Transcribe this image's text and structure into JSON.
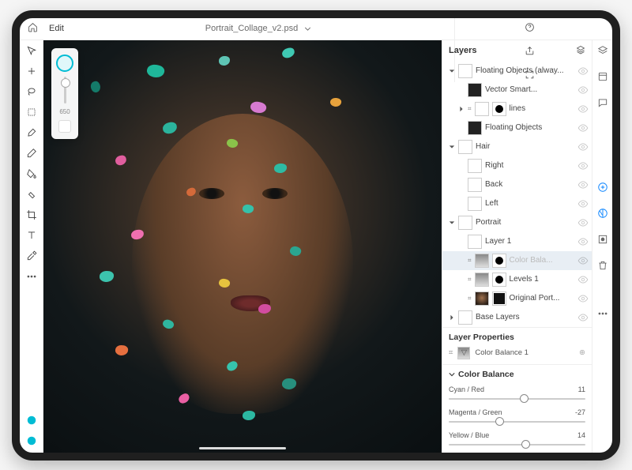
{
  "header": {
    "edit_label": "Edit",
    "filename": "Portrait_Collage_v2.psd"
  },
  "brush": {
    "size": "650"
  },
  "layers_panel": {
    "title": "Layers",
    "groups": [
      {
        "name": "Floating Objects (alway...",
        "expanded": true,
        "children": [
          {
            "name": "Vector Smart...",
            "thumb": "dark"
          },
          {
            "name": "lines",
            "thumb": "white",
            "mask": true,
            "collapsed": true
          },
          {
            "name": "Floating Objects",
            "thumb": "dark"
          }
        ]
      },
      {
        "name": "Hair",
        "expanded": true,
        "children": [
          {
            "name": "Right",
            "thumb": "white"
          },
          {
            "name": "Back",
            "thumb": "white"
          },
          {
            "name": "Left",
            "thumb": "white"
          }
        ]
      },
      {
        "name": "Portrait",
        "expanded": true,
        "children": [
          {
            "name": "Layer 1",
            "thumb": "white"
          },
          {
            "name": "Color Bala...",
            "thumb": "grad",
            "mask": true,
            "selected": true,
            "dim": true
          },
          {
            "name": "Levels 1",
            "thumb": "grad",
            "mask": true
          },
          {
            "name": "Original Port...",
            "thumb": "port",
            "mask_inv": true
          }
        ]
      },
      {
        "name": "Base Layers",
        "expanded": false
      }
    ]
  },
  "layer_properties": {
    "title": "Layer Properties",
    "current": "Color Balance 1"
  },
  "color_balance": {
    "title": "Color Balance",
    "sliders": [
      {
        "label": "Cyan / Red",
        "value": 11
      },
      {
        "label": "Magenta / Green",
        "value": -27
      },
      {
        "label": "Yellow / Blue",
        "value": 14
      }
    ]
  },
  "flecks": [
    {
      "t": 6,
      "l": 26,
      "w": 22,
      "h": 16,
      "c": "#1fb79a"
    },
    {
      "t": 4,
      "l": 44,
      "w": 14,
      "h": 12,
      "c": "#5ec4b4"
    },
    {
      "t": 10,
      "l": 12,
      "w": 12,
      "h": 14,
      "c": "#147a69"
    },
    {
      "t": 2,
      "l": 60,
      "w": 16,
      "h": 12,
      "c": "#3fc9b3"
    },
    {
      "t": 15,
      "l": 52,
      "w": 20,
      "h": 14,
      "c": "#d77ad0"
    },
    {
      "t": 14,
      "l": 72,
      "w": 14,
      "h": 11,
      "c": "#e7a23c"
    },
    {
      "t": 20,
      "l": 30,
      "w": 18,
      "h": 14,
      "c": "#2bb39c"
    },
    {
      "t": 24,
      "l": 46,
      "w": 14,
      "h": 11,
      "c": "#8ac34a"
    },
    {
      "t": 28,
      "l": 18,
      "w": 14,
      "h": 12,
      "c": "#e05e9e"
    },
    {
      "t": 30,
      "l": 58,
      "w": 16,
      "h": 12,
      "c": "#2ebba3"
    },
    {
      "t": 36,
      "l": 36,
      "w": 12,
      "h": 10,
      "c": "#d46a3a"
    },
    {
      "t": 40,
      "l": 50,
      "w": 14,
      "h": 11,
      "c": "#35c1aa"
    },
    {
      "t": 46,
      "l": 22,
      "w": 16,
      "h": 12,
      "c": "#ef6fb0"
    },
    {
      "t": 50,
      "l": 62,
      "w": 14,
      "h": 12,
      "c": "#2aa590"
    },
    {
      "t": 56,
      "l": 14,
      "w": 18,
      "h": 14,
      "c": "#3cc3ad"
    },
    {
      "t": 58,
      "l": 44,
      "w": 14,
      "h": 11,
      "c": "#e6c23e"
    },
    {
      "t": 64,
      "l": 54,
      "w": 16,
      "h": 12,
      "c": "#d24ca0"
    },
    {
      "t": 68,
      "l": 30,
      "w": 14,
      "h": 11,
      "c": "#2fb69f"
    },
    {
      "t": 74,
      "l": 18,
      "w": 16,
      "h": 13,
      "c": "#e56f3f"
    },
    {
      "t": 78,
      "l": 46,
      "w": 14,
      "h": 11,
      "c": "#36c4ad"
    },
    {
      "t": 82,
      "l": 60,
      "w": 18,
      "h": 14,
      "c": "#278f7d"
    },
    {
      "t": 86,
      "l": 34,
      "w": 14,
      "h": 11,
      "c": "#e95fa3"
    },
    {
      "t": 90,
      "l": 50,
      "w": 16,
      "h": 12,
      "c": "#2cb8a1"
    }
  ]
}
